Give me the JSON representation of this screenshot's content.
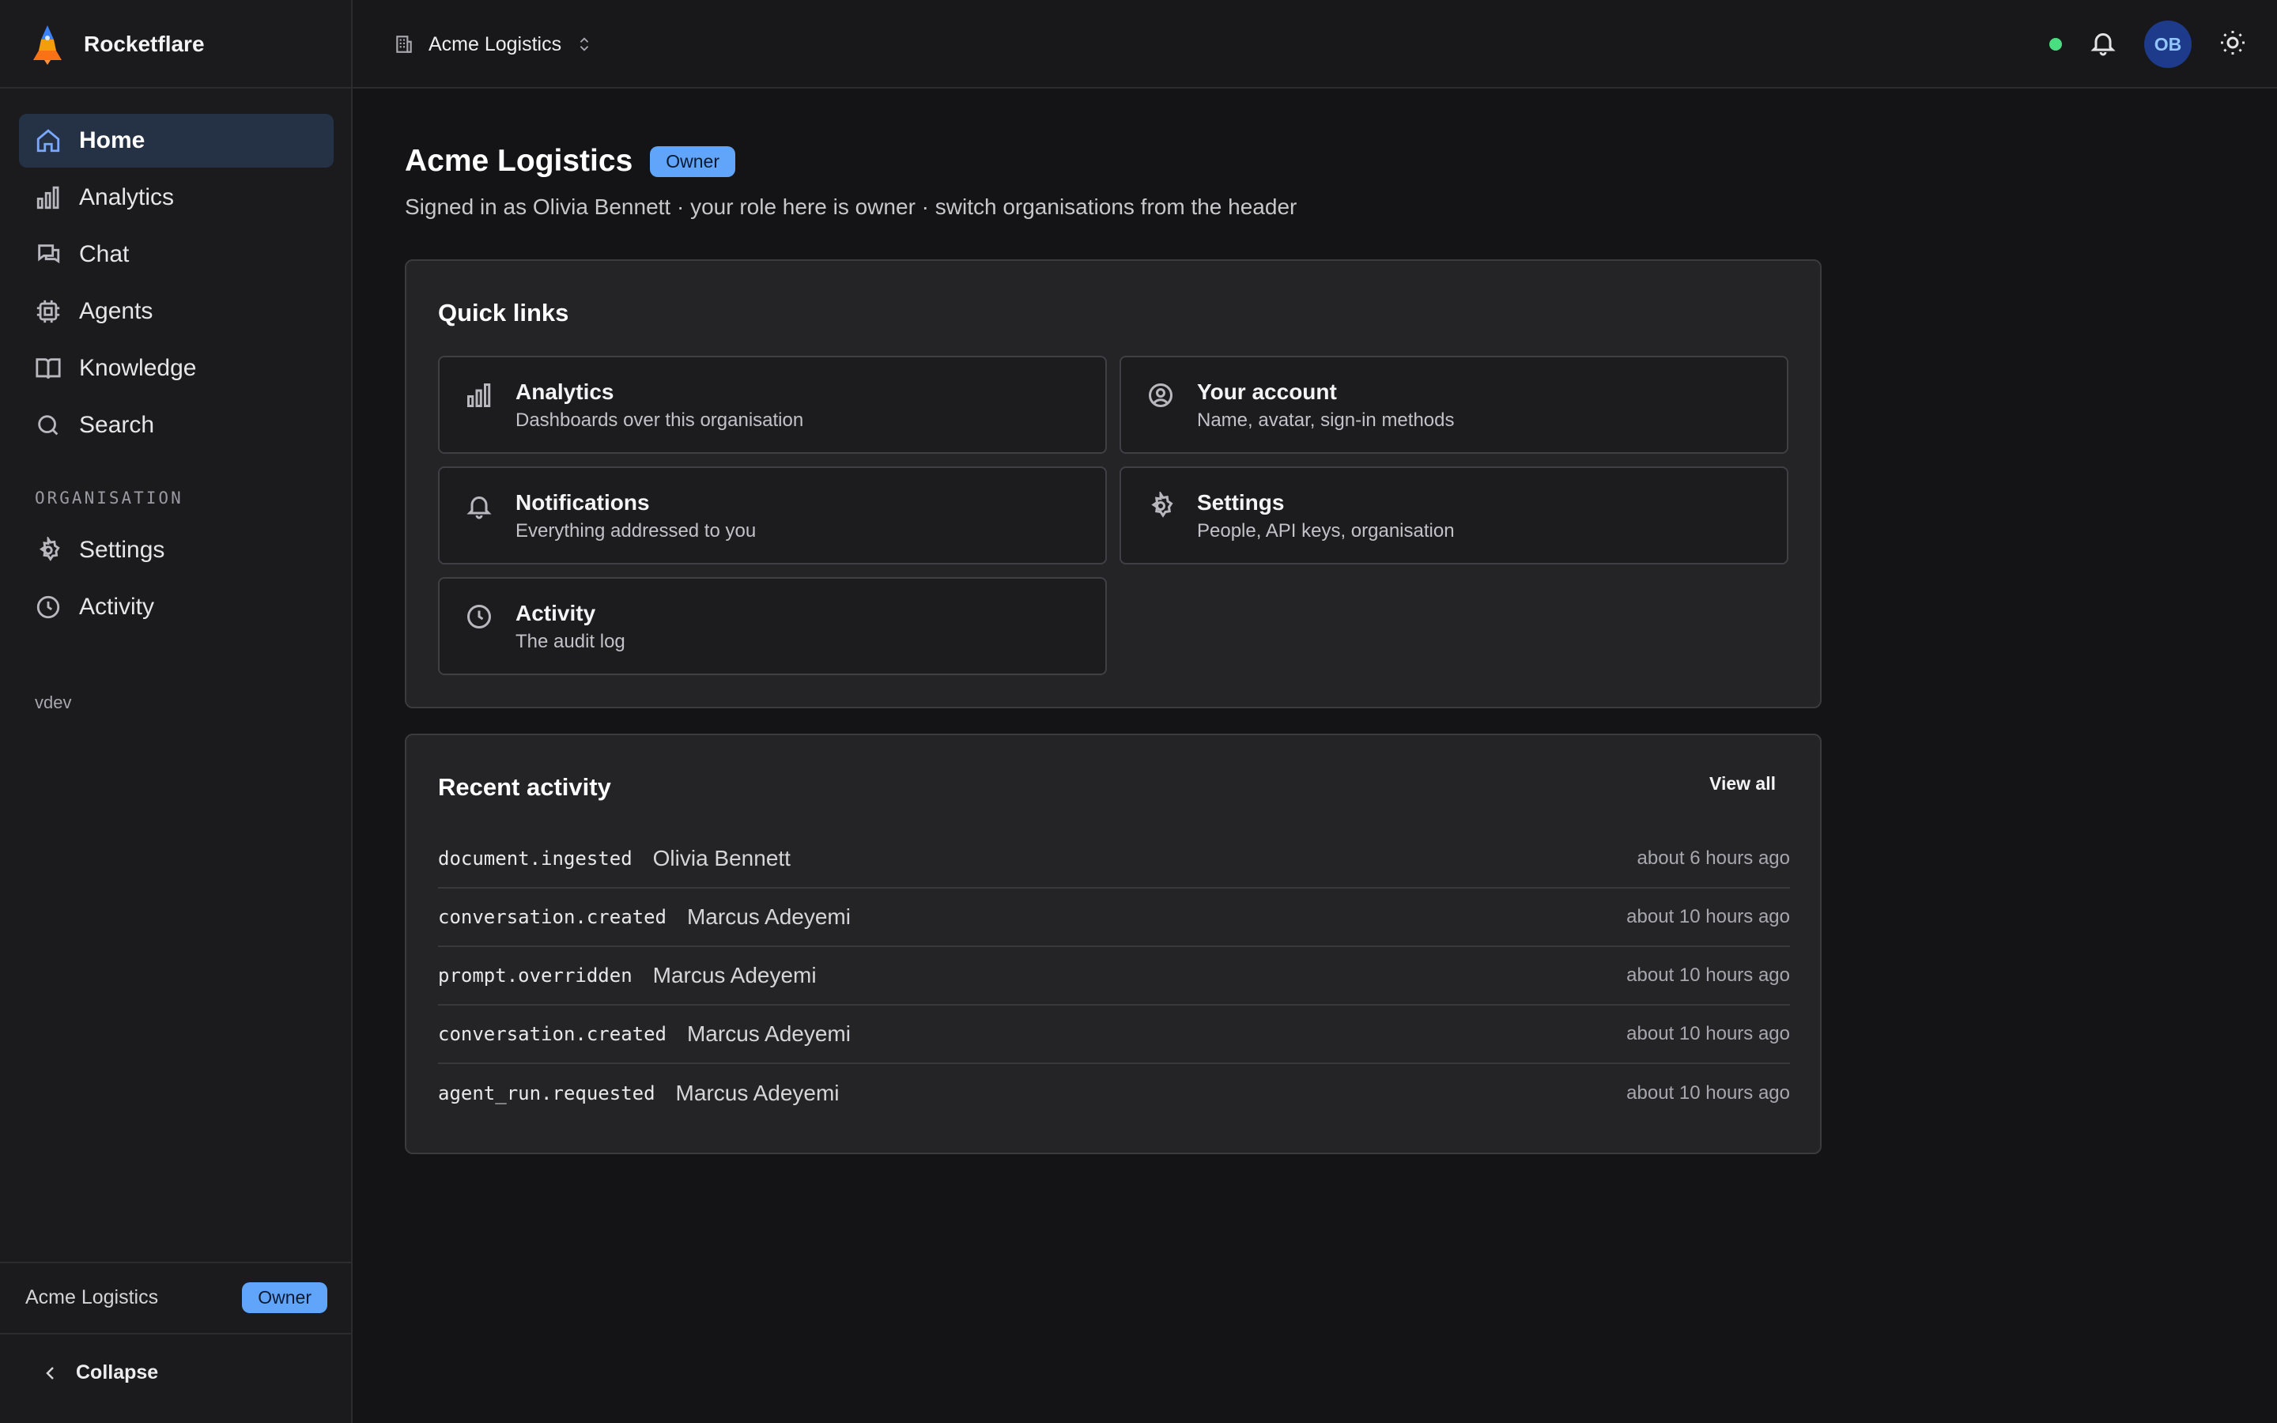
{
  "app": {
    "name": "Rocketflare",
    "version": "vdev"
  },
  "colors": {
    "accent": "#60a5fa",
    "active_nav_bg": "#253144",
    "status_online": "#4ade80"
  },
  "sidebar": {
    "nav_items": [
      {
        "label": "Home",
        "icon": "home-icon",
        "active": true
      },
      {
        "label": "Analytics",
        "icon": "bar-chart-icon"
      },
      {
        "label": "Chat",
        "icon": "chat-icon"
      },
      {
        "label": "Agents",
        "icon": "cpu-icon"
      },
      {
        "label": "Knowledge",
        "icon": "book-icon"
      },
      {
        "label": "Search",
        "icon": "search-icon"
      }
    ],
    "section_label": "ORGANISATION",
    "org_items": [
      {
        "label": "Settings",
        "icon": "gear-icon"
      },
      {
        "label": "Activity",
        "icon": "clock-icon"
      }
    ],
    "footer": {
      "org_name": "Acme Logistics",
      "role": "Owner",
      "collapse_label": "Collapse"
    }
  },
  "header": {
    "org_switcher": "Acme Logistics",
    "avatar_initials": "OB"
  },
  "main": {
    "title": "Acme Logistics",
    "role_badge": "Owner",
    "subtitle": "Signed in as Olivia Bennett · your role here is owner · switch organisations from the header",
    "quick_links": {
      "title": "Quick links",
      "items": [
        {
          "title": "Analytics",
          "desc": "Dashboards over this organisation",
          "icon": "bar-chart-icon"
        },
        {
          "title": "Your account",
          "desc": "Name, avatar, sign-in methods",
          "icon": "user-circle-icon"
        },
        {
          "title": "Notifications",
          "desc": "Everything addressed to you",
          "icon": "bell-icon"
        },
        {
          "title": "Settings",
          "desc": "People, API keys, organisation",
          "icon": "gear-icon"
        },
        {
          "title": "Activity",
          "desc": "The audit log",
          "icon": "clock-icon"
        }
      ]
    },
    "recent_activity": {
      "title": "Recent activity",
      "view_all": "View all",
      "rows": [
        {
          "event": "document.ingested",
          "actor": "Olivia Bennett",
          "time": "about 6 hours ago"
        },
        {
          "event": "conversation.created",
          "actor": "Marcus Adeyemi",
          "time": "about 10 hours ago"
        },
        {
          "event": "prompt.overridden",
          "actor": "Marcus Adeyemi",
          "time": "about 10 hours ago"
        },
        {
          "event": "conversation.created",
          "actor": "Marcus Adeyemi",
          "time": "about 10 hours ago"
        },
        {
          "event": "agent_run.requested",
          "actor": "Marcus Adeyemi",
          "time": "about 10 hours ago"
        }
      ]
    }
  }
}
